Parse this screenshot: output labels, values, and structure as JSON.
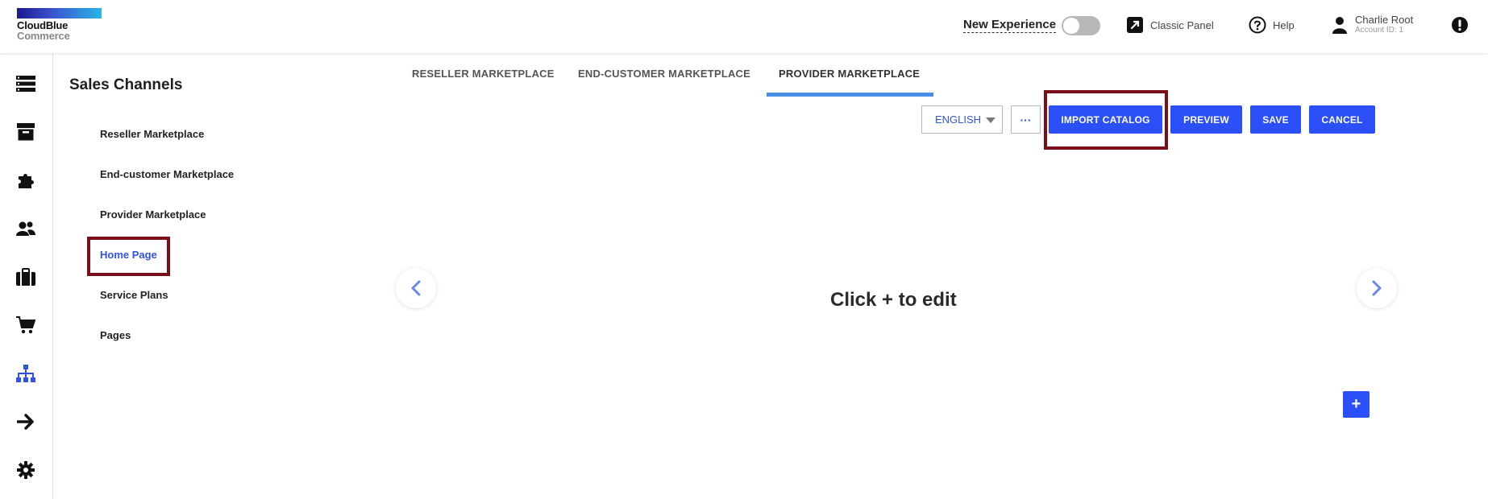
{
  "header": {
    "logo_line1": "CloudBlue",
    "logo_line2": "Commerce",
    "new_experience": "New Experience",
    "classic_panel": "Classic Panel",
    "help": "Help",
    "user_name": "Charlie Root",
    "account_id": "Account ID: 1"
  },
  "sidebar": {
    "title": "Sales Channels",
    "items": [
      {
        "label": "Reseller Marketplace"
      },
      {
        "label": "End-customer Marketplace"
      },
      {
        "label": "Provider Marketplace"
      },
      {
        "label": "Home Page"
      },
      {
        "label": "Service Plans"
      },
      {
        "label": "Pages"
      }
    ],
    "active": "Home Page"
  },
  "tabs": [
    {
      "label": "RESELLER MARKETPLACE"
    },
    {
      "label": "END-CUSTOMER MARKETPLACE"
    },
    {
      "label": "PROVIDER MARKETPLACE"
    }
  ],
  "active_tab": "PROVIDER MARKETPLACE",
  "toolbar": {
    "language": "ENGLISH",
    "more": "···",
    "import_catalog": "IMPORT CATALOG",
    "preview": "PREVIEW",
    "save": "SAVE",
    "cancel": "CANCEL"
  },
  "canvas": {
    "placeholder": "Click + to edit",
    "add": "+"
  },
  "colors": {
    "accent": "#2b4ff8",
    "active_link": "#3253e0",
    "highlight_border": "#7a0f1a",
    "tab_underline": "#4a8ee8"
  },
  "icons": {
    "rail": [
      "dashboard-icon",
      "archive-icon",
      "puzzle-icon",
      "users-icon",
      "briefcase-icon",
      "cart-icon",
      "sitemap-icon",
      "arrow-right-icon",
      "gear-icon"
    ]
  }
}
